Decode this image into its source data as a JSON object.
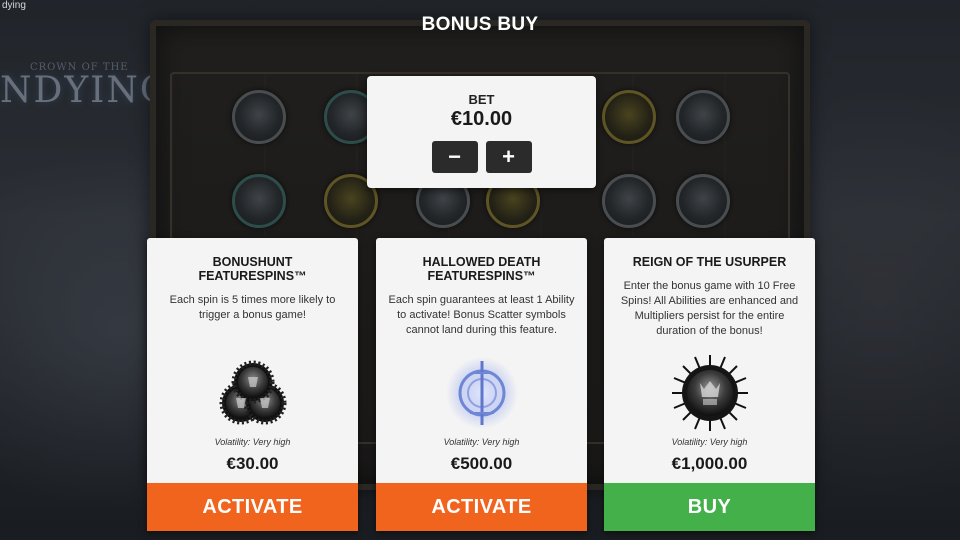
{
  "corner_text": "dying",
  "game_logo": {
    "sub": "CROWN OF THE",
    "main": "NDYING"
  },
  "title": "BONUS BUY",
  "bet": {
    "label": "BET",
    "value": "€10.00",
    "decrease_symbol": "−",
    "increase_symbol": "+"
  },
  "options": [
    {
      "title_line1": "BONUSHUNT",
      "title_line2": "FEATURESPINS™",
      "description": "Each spin is 5 times more likely to trigger a bonus game!",
      "icon": "triple-spiked-orbs-icon",
      "volatility": "Volatility: Very high",
      "price": "€30.00",
      "button": "ACTIVATE",
      "button_color": "#f1641e"
    },
    {
      "title_line1": "HALLOWED DEATH",
      "title_line2": "FEATURESPINS™",
      "description": "Each spin guarantees at least 1 Ability to activate! Bonus Scatter symbols cannot land during this feature.",
      "icon": "glowing-rune-sigil-icon",
      "volatility": "Volatility: Very high",
      "price": "€500.00",
      "button": "ACTIVATE",
      "button_color": "#f1641e"
    },
    {
      "title_line1": "REIGN OF THE USURPER",
      "title_line2": "",
      "description": "Enter the bonus game with 10 Free Spins! All Abilities are enhanced and Multipliers persist for the entire duration of the bonus!",
      "icon": "spiked-crown-emblem-icon",
      "volatility": "Volatility: Very high",
      "price": "€1,000.00",
      "button": "BUY",
      "button_color": "#43b04a"
    }
  ]
}
